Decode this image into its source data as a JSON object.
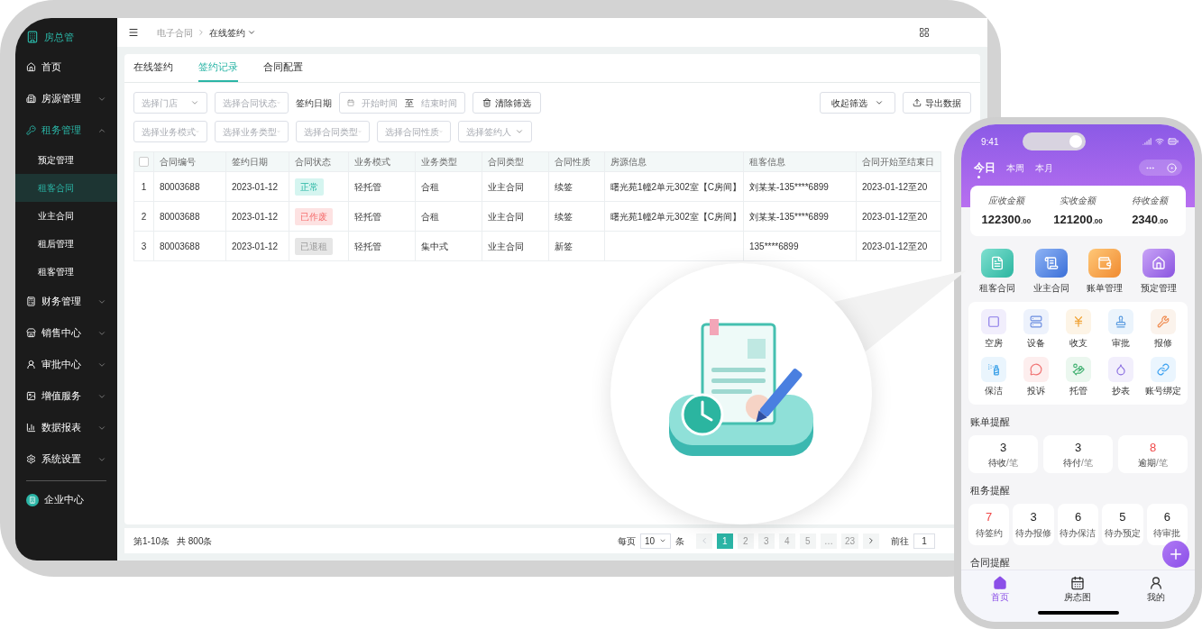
{
  "sidebar": {
    "logo": "房总管",
    "items": [
      {
        "label": "首页"
      },
      {
        "label": "房源管理",
        "expanded": false
      },
      {
        "label": "租务管理",
        "expanded": true,
        "children": [
          {
            "label": "预定管理",
            "selected": false
          },
          {
            "label": "租客合同",
            "selected": true
          },
          {
            "label": "业主合同",
            "selected": false
          },
          {
            "label": "租后管理",
            "selected": false
          },
          {
            "label": "租客管理",
            "selected": false
          }
        ]
      },
      {
        "label": "财务管理",
        "expanded": false
      },
      {
        "label": "销售中心",
        "expanded": false
      },
      {
        "label": "审批中心",
        "expanded": false
      },
      {
        "label": "增值服务",
        "expanded": false
      },
      {
        "label": "数据报表",
        "expanded": false
      },
      {
        "label": "系统设置",
        "expanded": false
      }
    ],
    "footer": "企业中心"
  },
  "breadcrumb": {
    "parent": "电子合同",
    "current": "在线签约"
  },
  "tabs": [
    {
      "label": "在线签约",
      "selected": false
    },
    {
      "label": "签约记录",
      "selected": true
    },
    {
      "label": "合同配置",
      "selected": false
    }
  ],
  "filters": {
    "row_1": [
      {
        "placeholder": "选择门店"
      },
      {
        "placeholder": "选择合同状态"
      }
    ],
    "date_label": "签约日期",
    "date_start": "开始时间",
    "date_sep": "至",
    "date_end": "结束时间",
    "clear": "清除筛选",
    "collapse": "收起筛选",
    "export": "导出数据",
    "row_2": [
      {
        "placeholder": "选择业务模式"
      },
      {
        "placeholder": "选择业务类型"
      },
      {
        "placeholder": "选择合同类型"
      },
      {
        "placeholder": "选择合同性质"
      },
      {
        "placeholder": "选择签约人"
      }
    ]
  },
  "table": {
    "all_checked": false,
    "columns": [
      "合同编号",
      "签约日期",
      "合同状态",
      "业务模式",
      "业务类型",
      "合同类型",
      "合同性质",
      "房源信息",
      "租客信息",
      "合同开始至结束日"
    ],
    "rows": [
      {
        "index": "1",
        "id": "80003688",
        "date": "2023-01-12",
        "status": {
          "label": "正常",
          "kind": "normal"
        },
        "mode": "轻托管",
        "biz_type": "合租",
        "contract_type": "业主合同",
        "nature": "续签",
        "property": "曙光苑1幢2单元302室【C房间】",
        "tenant": "刘某某-135****6899",
        "period": "2023-01-12至20"
      },
      {
        "index": "2",
        "id": "80003688",
        "date": "2023-01-12",
        "status": {
          "label": "已作废",
          "kind": "voided"
        },
        "mode": "轻托管",
        "biz_type": "合租",
        "contract_type": "业主合同",
        "nature": "续签",
        "property": "曙光苑1幢2单元302室【C房间】",
        "tenant": "刘某某-135****6899",
        "period": "2023-01-12至20"
      },
      {
        "index": "3",
        "id": "80003688",
        "date": "2023-01-12",
        "status": {
          "label": "已退租",
          "kind": "retired"
        },
        "mode": "轻托管",
        "biz_type": "集中式",
        "contract_type": "业主合同",
        "nature": "新签",
        "tenant": "135****6899",
        "period": "2023-01-12至20"
      }
    ]
  },
  "pagination": {
    "range": "第1-10条",
    "total": "共 800条",
    "per_page_label": "每页",
    "per_page": "10",
    "unit": "条",
    "prev_disabled": true,
    "pages": [
      {
        "label": "1",
        "selected": true
      },
      {
        "label": "2",
        "selected": false
      },
      {
        "label": "3",
        "selected": false
      },
      {
        "label": "4",
        "selected": false
      },
      {
        "label": "5",
        "selected": false
      },
      {
        "label": "…",
        "selected": false
      },
      {
        "label": "23",
        "selected": false
      }
    ],
    "goto_label": "前往",
    "goto_value": "1"
  },
  "phone": {
    "time": "9:41",
    "periods": [
      {
        "label": "今日",
        "selected": true
      },
      {
        "label": "本周",
        "selected": false
      },
      {
        "label": "本月",
        "selected": false
      }
    ],
    "summary": [
      {
        "label": "应收金额",
        "amount": "122300",
        "decimals": ".00"
      },
      {
        "label": "实收金额",
        "amount": "121200",
        "decimals": ".00"
      },
      {
        "label": "待收金额",
        "amount": "2340",
        "decimals": ".00"
      }
    ],
    "shortcuts": [
      "租客合同",
      "业主合同",
      "账单管理",
      "预定管理"
    ],
    "tools": [
      "空房",
      "设备",
      "收支",
      "审批",
      "报修",
      "保洁",
      "投诉",
      "托管",
      "抄表",
      "账号绑定"
    ],
    "bill_reminders": {
      "title": "账单提醒",
      "items": [
        {
          "count": "3",
          "label": "待收",
          "unit": "/笔",
          "alert": false
        },
        {
          "count": "3",
          "label": "待付",
          "unit": "/笔",
          "alert": false
        },
        {
          "count": "8",
          "label": "逾期",
          "unit": "/笔",
          "alert": true
        }
      ]
    },
    "lease_reminders": {
      "title": "租务提醒",
      "items": [
        {
          "count": "7",
          "label": "待签约",
          "alert": true
        },
        {
          "count": "3",
          "label": "待办报修",
          "alert": false
        },
        {
          "count": "6",
          "label": "待办保洁",
          "alert": false
        },
        {
          "count": "5",
          "label": "待办预定",
          "alert": false
        },
        {
          "count": "6",
          "label": "待审批",
          "alert": false
        }
      ]
    },
    "contract_reminders": {
      "title": "合同提醒"
    },
    "nav": [
      {
        "label": "首页",
        "selected": true
      },
      {
        "label": "房态图",
        "selected": false
      },
      {
        "label": "我的",
        "selected": false
      }
    ]
  }
}
